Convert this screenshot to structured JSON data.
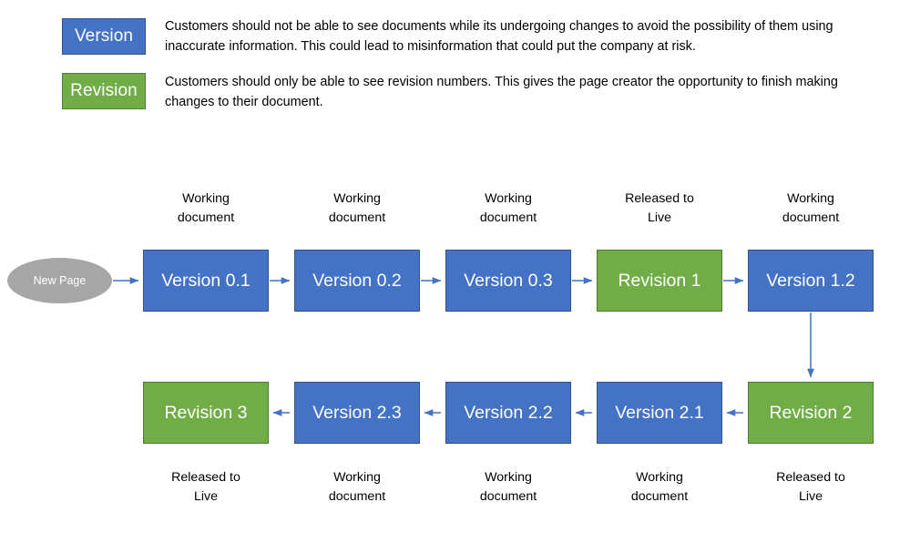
{
  "legend": {
    "items": [
      {
        "key": "version",
        "label": "Version",
        "color": "#4472C4",
        "border": "#2F528F",
        "description": "Customers should not be able to see documents while its undergoing changes to avoid the possibility of them using inaccurate information. This could lead to misinformation that could put the company at risk."
      },
      {
        "key": "revision",
        "label": "Revision",
        "color": "#70AD47",
        "border": "#507E32",
        "description": "Customers should only be able to see revision numbers. This gives the page creator the opportunity to finish making changes to their document."
      }
    ]
  },
  "diagram": {
    "start_node": {
      "label": "New Page",
      "shape": "ellipse",
      "color": "#A6A6A6"
    },
    "arrow_color": "#4472C4",
    "row1": {
      "flow_direction": "left-to-right",
      "caption_position": "above",
      "nodes": [
        {
          "label": "Version 0.1",
          "type": "version",
          "caption": "Working\ndocument"
        },
        {
          "label": "Version 0.2",
          "type": "version",
          "caption": "Working\ndocument"
        },
        {
          "label": "Version 0.3",
          "type": "version",
          "caption": "Working\ndocument"
        },
        {
          "label": "Revision 1",
          "type": "revision",
          "caption": "Released to\nLive"
        },
        {
          "label": "Version 1.2",
          "type": "version",
          "caption": "Working\ndocument"
        }
      ]
    },
    "row2": {
      "flow_direction": "right-to-left",
      "caption_position": "below",
      "nodes": [
        {
          "label": "Revision 3",
          "type": "revision",
          "caption": "Released to\nLive"
        },
        {
          "label": "Version 2.3",
          "type": "version",
          "caption": "Working\ndocument"
        },
        {
          "label": "Version 2.2",
          "type": "version",
          "caption": "Working\ndocument"
        },
        {
          "label": "Version 2.1",
          "type": "version",
          "caption": "Working\ndocument"
        },
        {
          "label": "Revision 2",
          "type": "revision",
          "caption": "Released to\nLive"
        }
      ]
    }
  }
}
